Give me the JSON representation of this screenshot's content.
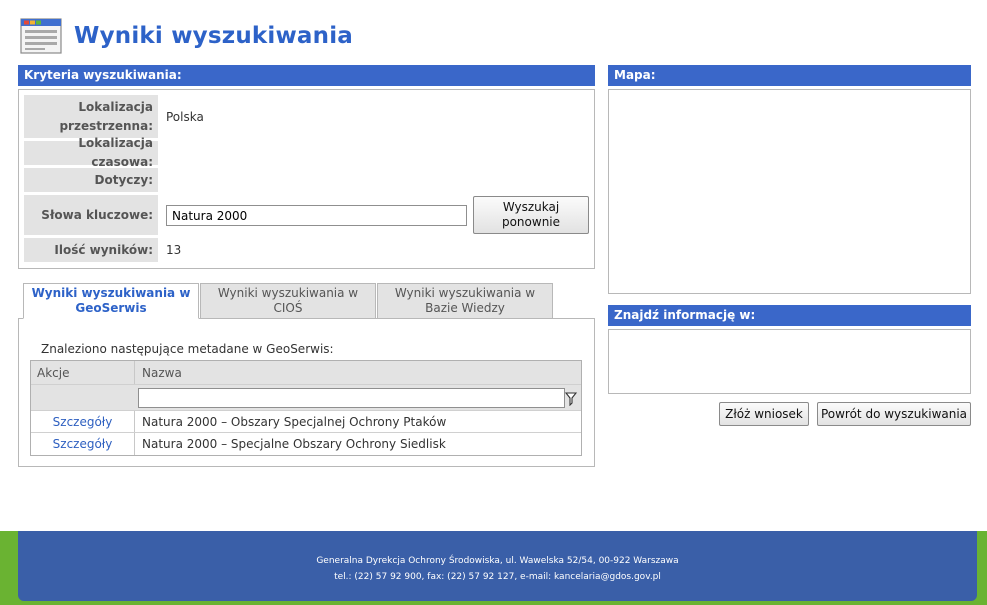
{
  "header": {
    "title": "Wyniki wyszukiwania",
    "icon": "document-list-icon"
  },
  "criteria": {
    "title": "Kryteria wyszukiwania:",
    "rows": [
      {
        "label": "Lokalizacja przestrzenna:",
        "value": "Polska"
      },
      {
        "label": "Lokalizacja czasowa:",
        "value": ""
      },
      {
        "label": "Dotyczy:",
        "value": ""
      },
      {
        "label": "Słowa kluczowe:",
        "value": "Natura 2000"
      },
      {
        "label": "Ilość wyników:",
        "value": "13"
      }
    ],
    "search_again_button": "Wyszukaj ponownie"
  },
  "map": {
    "title": "Mapa:"
  },
  "find_info": {
    "title": "Znajdź informację w:"
  },
  "actions": {
    "submit_request": "Złóż wniosek",
    "back_to_search": "Powrót do wyszukiwania"
  },
  "tabs": [
    {
      "label": "Wyniki wyszukiwania w GeoSerwis",
      "active": true
    },
    {
      "label": "Wyniki wyszukiwania w CIOŚ",
      "active": false
    },
    {
      "label": "Wyniki wyszukiwania w Bazie Wiedzy",
      "active": false
    }
  ],
  "results": {
    "heading": "Znaleziono następujące metadane w GeoSerwis:",
    "columns": [
      "Akcje",
      "Nazwa"
    ],
    "filter_value": "",
    "rows": [
      {
        "action": "Szczegóły",
        "name": "Natura 2000 – Obszary Specjalnej Ochrony Ptaków"
      },
      {
        "action": "Szczegóły",
        "name": "Natura 2000 – Specjalne Obszary Ochrony Siedlisk"
      }
    ]
  },
  "footer": {
    "line1": "Generalna Dyrekcja Ochrony Środowiska, ul. Wawelska 52/54, 00-922 Warszawa",
    "line2": "tel.: (22) 57 92 900, fax: (22) 57 92 127, e-mail: kancelaria@gdos.gov.pl"
  },
  "colors": {
    "accent": "#3a67c9",
    "title": "#2d62c8",
    "footer_blue": "#3a5fa8",
    "footer_green": "#6ab332",
    "label_bg": "#e3e3e3"
  }
}
